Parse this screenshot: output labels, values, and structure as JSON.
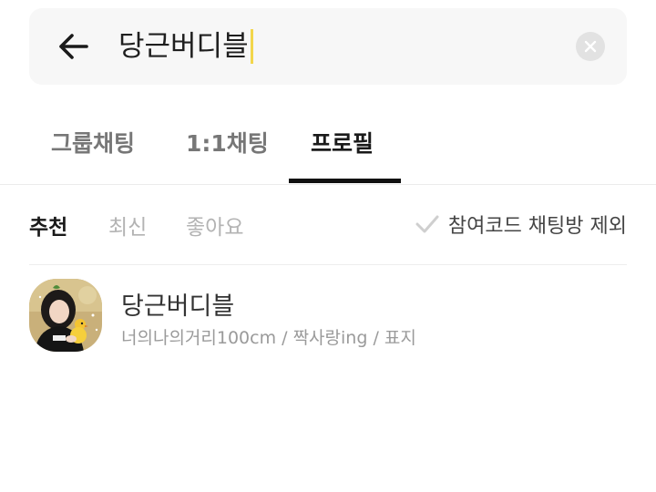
{
  "search": {
    "query": "당근버디블"
  },
  "tabs": [
    {
      "label": "그룹채팅"
    },
    {
      "label": "1:1채팅"
    },
    {
      "label": "프로필"
    }
  ],
  "active_tab": "프로필",
  "filters": [
    {
      "label": "추천"
    },
    {
      "label": "최신"
    },
    {
      "label": "좋아요"
    }
  ],
  "active_filter": "추천",
  "exclude_joined": {
    "label": "참여코드 채팅방 제외",
    "checked": false
  },
  "results": [
    {
      "name": "당근버디블",
      "description": "너의나의거리100cm / 짝사랑ing / 표지"
    }
  ],
  "icons": {
    "back": "arrow-left-icon",
    "clear": "close-circle-icon",
    "check": "check-icon"
  },
  "colors": {
    "caret": "#f2d64b",
    "search_bg": "#f7f7f7",
    "active_tab_indicator": "#111111"
  }
}
